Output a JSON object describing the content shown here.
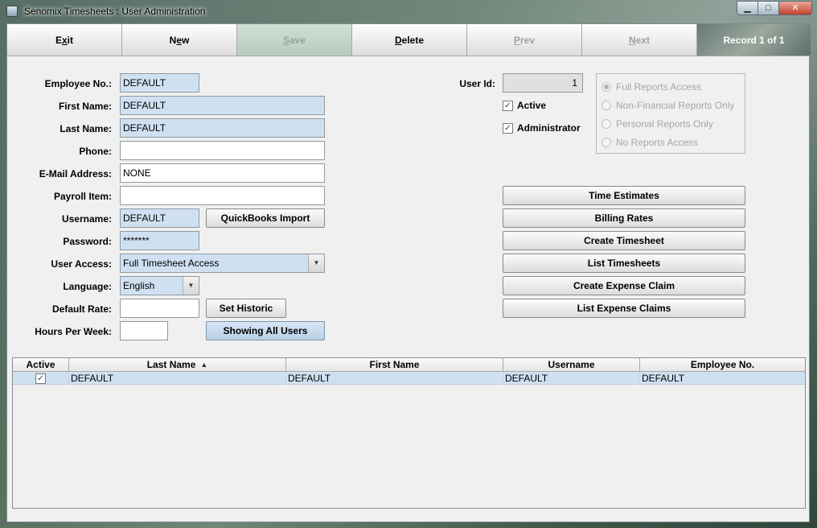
{
  "window": {
    "title": "Senomix Timesheets : User Administration",
    "min": "▁",
    "max": "□",
    "close": "✕"
  },
  "toolbar": {
    "exit_pre": "E",
    "exit_u": "x",
    "exit_post": "it",
    "new_pre": "N",
    "new_u": "e",
    "new_post": "w",
    "save_pre": "",
    "save_u": "S",
    "save_post": "ave",
    "delete_pre": "",
    "delete_u": "D",
    "delete_post": "elete",
    "prev_pre": "",
    "prev_u": "P",
    "prev_post": "rev",
    "next_pre": "",
    "next_u": "N",
    "next_post": "ext",
    "record": "Record 1 of 1"
  },
  "form": {
    "employee_no_label": "Employee No.:",
    "employee_no": "DEFAULT",
    "first_name_label": "First Name:",
    "first_name": "DEFAULT",
    "last_name_label": "Last Name:",
    "last_name": "DEFAULT",
    "phone_label": "Phone:",
    "phone": "",
    "email_label": "E-Mail Address:",
    "email": "NONE",
    "payroll_label": "Payroll Item:",
    "payroll": "",
    "username_label": "Username:",
    "username": "DEFAULT",
    "password_label": "Password:",
    "password": "*******",
    "user_access_label": "User Access:",
    "user_access": "Full Timesheet Access",
    "language_label": "Language:",
    "language": "English",
    "default_rate_label": "Default Rate:",
    "default_rate": "",
    "hours_label": "Hours Per Week:",
    "hours": "",
    "quickbooks_button": "QuickBooks Import",
    "set_historic_button": "Set Historic",
    "showing_all_button": "Showing All Users",
    "user_id_label": "User Id:",
    "user_id": "1",
    "active_label": "Active",
    "active_checked": "✓",
    "admin_label": "Administrator",
    "admin_checked": "✓"
  },
  "reports": {
    "options": [
      "Full Reports Access",
      "Non-Financial Reports Only",
      "Personal Reports Only",
      "No Reports Access"
    ]
  },
  "actions": {
    "time_estimates": "Time Estimates",
    "billing_rates": "Billing Rates",
    "create_timesheet": "Create Timesheet",
    "list_timesheets": "List Timesheets",
    "create_expense_claim": "Create Expense Claim",
    "list_expense_claims": "List Expense Claims"
  },
  "grid": {
    "columns": [
      "Active",
      "Last Name",
      "First Name",
      "Username",
      "Employee No."
    ],
    "sort_icon": "▲",
    "rows": [
      {
        "active": "✓",
        "last_name": "DEFAULT",
        "first_name": "DEFAULT",
        "username": "DEFAULT",
        "employee_no": "DEFAULT"
      }
    ]
  },
  "colors": {
    "field_blue": "#cfe1f1",
    "selection": "#cfe1f1"
  }
}
